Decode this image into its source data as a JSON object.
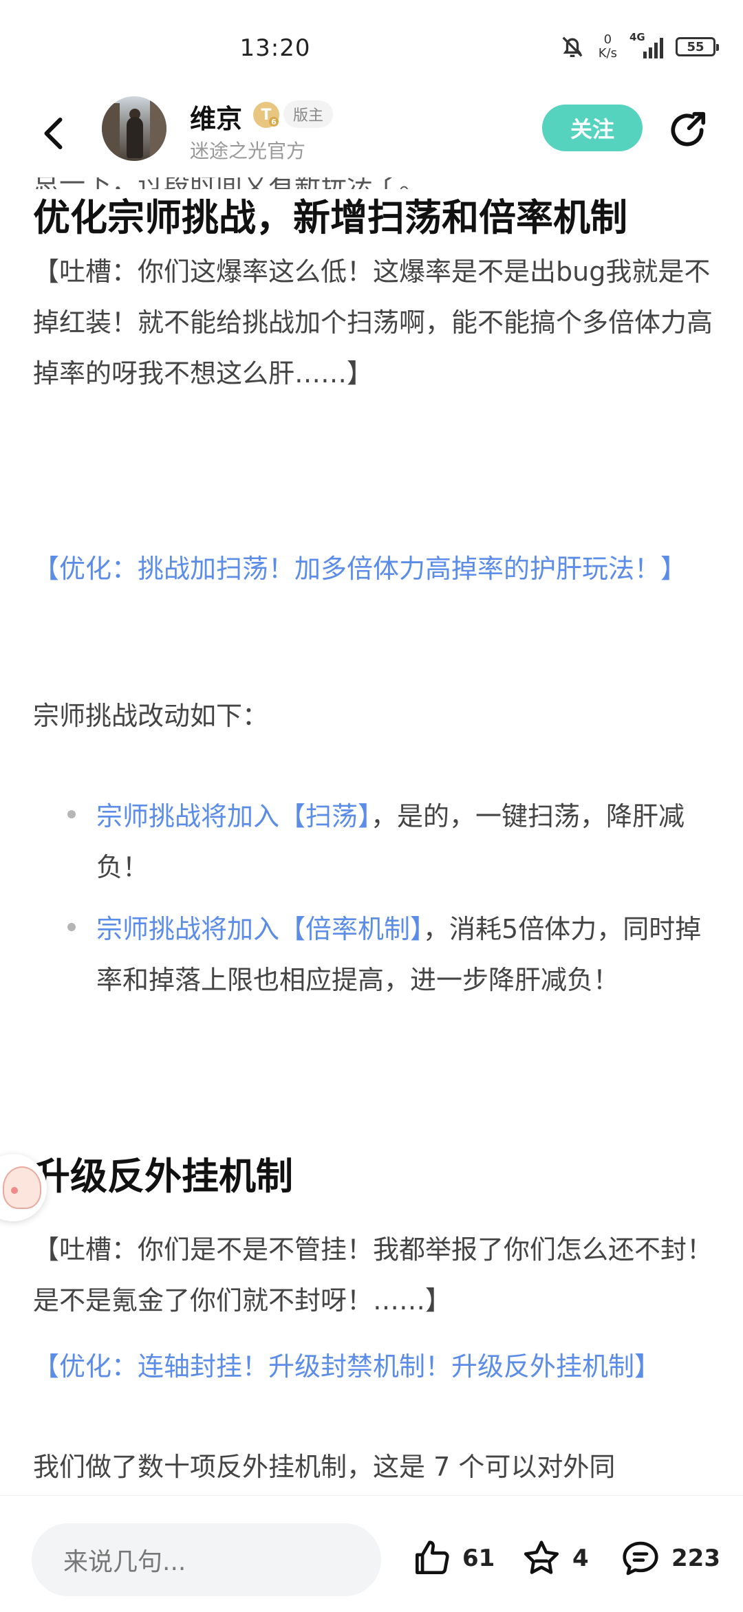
{
  "status_bar": {
    "time": "13:20",
    "net_speed_value": "0",
    "net_speed_unit": "K/s",
    "network": "4G",
    "battery": "55"
  },
  "header": {
    "author_name": "维京",
    "level_badge": "T",
    "level_sub": "6",
    "role_badge": "版主",
    "author_subtitle": "迷途之光官方",
    "follow_label": "关注"
  },
  "article": {
    "cut_line": "总一下，过段时间又有新玩法了。",
    "section1": {
      "heading": "优化宗师挑战，新增扫荡和倍率机制",
      "complaint": "【吐槽：你们这爆率这么低！这爆率是不是出bug我就是不掉红装！就不能给挑战加个扫荡啊，能不能搞个多倍体力高掉率的呀我不想这么肝……】",
      "optimization": "【优化：挑战加扫荡！加多倍体力高掉率的护肝玩法！】",
      "intro": "宗师挑战改动如下：",
      "bullets": [
        {
          "highlight": "宗师挑战将加入【扫荡】",
          "text": "，是的，一键扫荡，降肝减负！"
        },
        {
          "highlight": "宗师挑战将加入【倍率机制】",
          "text": "，消耗5倍体力，同时掉率和掉落上限也相应提高，进一步降肝减负！"
        }
      ]
    },
    "section2": {
      "heading": "升级反外挂机制",
      "complaint": "【吐槽：你们是不是不管挂！我都举报了你们怎么还不封！是不是氪金了你们就不封呀！……】",
      "optimization": "【优化：连轴封挂！升级封禁机制！升级反外挂机制】",
      "partial": "我们做了数十项反外挂机制，这是 7 个可以对外同"
    }
  },
  "bottom_bar": {
    "comment_placeholder": "来说几句...",
    "likes": "61",
    "favorites": "4",
    "comments": "223"
  }
}
